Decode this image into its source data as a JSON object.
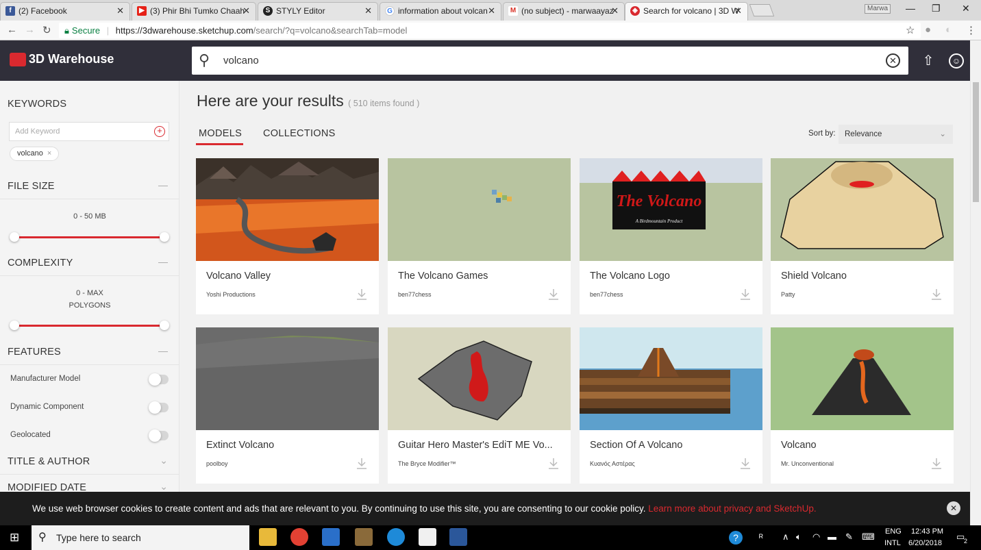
{
  "browser": {
    "tabs": [
      {
        "title": "(2) Facebook",
        "icon": "facebook-icon",
        "color": "#3b5998"
      },
      {
        "title": "(3) Phir Bhi Tumko Chaah",
        "icon": "youtube-icon",
        "color": "#e62117"
      },
      {
        "title": "STYLY Editor",
        "icon": "styly-icon",
        "color": "#222222"
      },
      {
        "title": "information about volcan",
        "icon": "google-icon",
        "color": "#4285f4"
      },
      {
        "title": "(no subject) - marwaayaz",
        "icon": "gmail-icon",
        "color": "#d93025"
      },
      {
        "title": "Search for volcano | 3D W",
        "icon": "3d-warehouse-icon",
        "color": "#d9292f"
      }
    ],
    "user": "Marwa",
    "secure_label": "Secure",
    "url_host": "https://3dwarehouse.sketchup.com",
    "url_path": "/search/?q=volcano&searchTab=model"
  },
  "site": {
    "brand": "3D Warehouse",
    "accent": "#d9292f",
    "search_value": "volcano"
  },
  "sidebar": {
    "keywords_title": "KEYWORDS",
    "keyword_placeholder": "Add Keyword",
    "keyword_chip": "volcano",
    "file_size_title": "FILE SIZE",
    "file_size_range": "0 - 50 MB",
    "complexity_title": "COMPLEXITY",
    "complexity_range": "0 - MAX",
    "complexity_unit": "POLYGONS",
    "features_title": "FEATURES",
    "features": [
      {
        "label": "Manufacturer Model",
        "on": false
      },
      {
        "label": "Dynamic Component",
        "on": false
      },
      {
        "label": "Geolocated",
        "on": false
      }
    ],
    "title_author_title": "TITLE & AUTHOR",
    "modified_date_title": "MODIFIED DATE"
  },
  "results": {
    "heading": "Here are your results",
    "count": "( 510 items found )",
    "tabs": [
      "MODELS",
      "COLLECTIONS"
    ],
    "sort_label": "Sort by:",
    "sort_value": "Relevance",
    "cards": [
      {
        "title": "Volcano Valley",
        "author": "Yoshi Productions"
      },
      {
        "title": "The Volcano Games",
        "author": "ben77chess"
      },
      {
        "title": "The Volcano Logo",
        "author": "ben77chess",
        "logo_text": "The Volcano",
        "logo_sub": "A Birdmountain Product"
      },
      {
        "title": "Shield Volcano",
        "author": "Patty"
      },
      {
        "title": "Extinct Volcano",
        "author": "poolboy"
      },
      {
        "title": "Guitar Hero Master's EdiT ME Vo...",
        "author": "The Bryce Modifier™"
      },
      {
        "title": "Section Of A Volcano",
        "author": "Κυανός Αστέρας"
      },
      {
        "title": "Volcano",
        "author": "Mr. Unconventional"
      }
    ]
  },
  "cookie": {
    "message": "We use web browser cookies to create content and ads that are relevant to you. By continuing to use this site, you are consenting to our cookie policy.",
    "link": "Learn more about privacy and SketchUp."
  },
  "taskbar": {
    "search_placeholder": "Type here to search",
    "lang": "ENG",
    "lang2": "INTL",
    "time": "12:43 PM",
    "date": "6/20/2018",
    "notifications": "2"
  }
}
